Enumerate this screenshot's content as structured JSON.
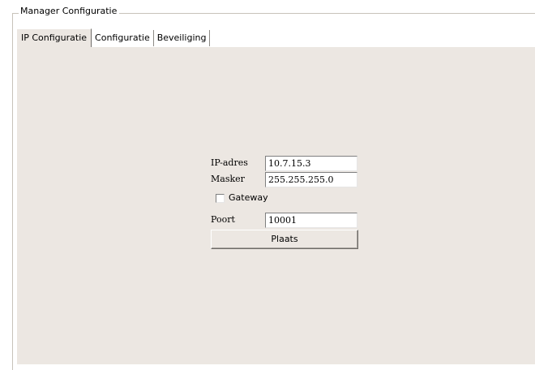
{
  "group": {
    "title": "Manager Configuratie"
  },
  "tabs": [
    {
      "label": "IP Configuratie",
      "active": true
    },
    {
      "label": "Configuratie",
      "active": false
    },
    {
      "label": "Beveiliging",
      "active": false
    }
  ],
  "form": {
    "ip_label": "IP-adres",
    "ip_value": "10.7.15.3",
    "mask_label": "Masker",
    "mask_value": "255.255.255.0",
    "gateway_label": "Gateway",
    "gateway_checked": false,
    "port_label": "Poort",
    "port_value": "10001",
    "submit_label": "Plaats"
  }
}
